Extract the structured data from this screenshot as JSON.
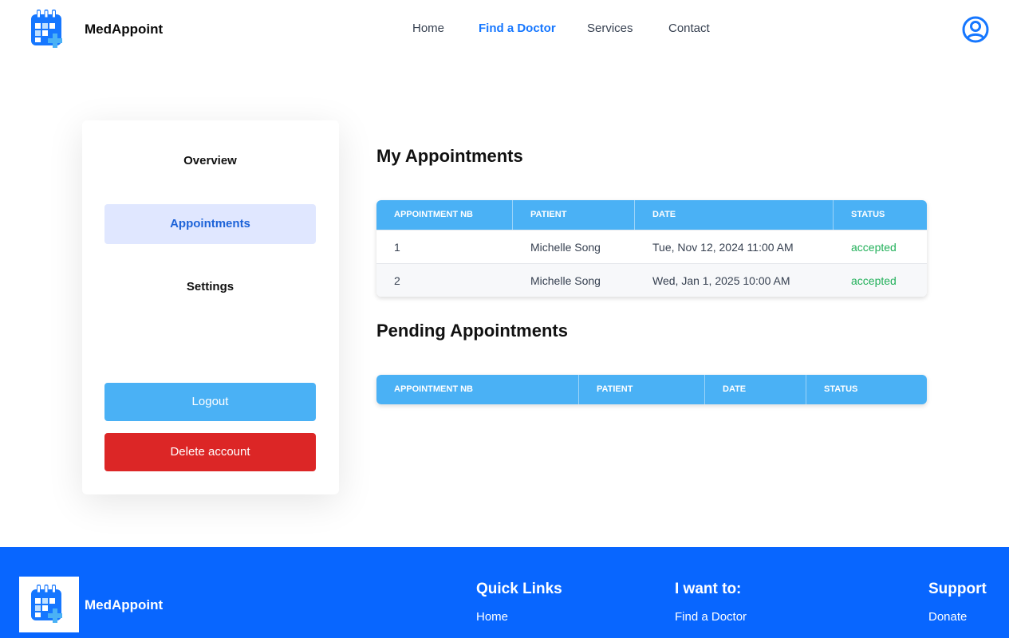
{
  "app": {
    "brand": "MedAppoint"
  },
  "nav": {
    "home": "Home",
    "find_doctor": "Find a Doctor",
    "services": "Services",
    "contact": "Contact"
  },
  "sidebar": {
    "overview": "Overview",
    "appointments": "Appointments",
    "settings": "Settings",
    "logout": "Logout",
    "delete_account": "Delete account"
  },
  "my_appointments": {
    "title": "My Appointments",
    "columns": [
      "APPOINTMENT NB",
      "PATIENT",
      "DATE",
      "STATUS"
    ],
    "rows": [
      {
        "nb": "1",
        "patient": "Michelle Song",
        "date": "Tue, Nov 12, 2024 11:00 AM",
        "status": "accepted"
      },
      {
        "nb": "2",
        "patient": "Michelle Song",
        "date": "Wed, Jan 1, 2025 10:00 AM",
        "status": "accepted"
      }
    ]
  },
  "pending_appointments": {
    "title": "Pending Appointments",
    "columns": [
      "APPOINTMENT NB",
      "PATIENT",
      "DATE",
      "STATUS"
    ],
    "rows": []
  },
  "footer": {
    "brand": "MedAppoint",
    "quick_links": {
      "title": "Quick Links",
      "first_link": "Home"
    },
    "i_want_to": {
      "title": "I want to:",
      "first_link": "Find a Doctor"
    },
    "support": {
      "title": "Support",
      "first_link": "Donate"
    }
  },
  "colors": {
    "primary": "#0866ff",
    "table_header": "#4ab1f5",
    "danger": "#dc2626",
    "success": "#22b05a",
    "active_bg": "#e0e7ff"
  },
  "icons": {
    "logo": "calendar-plus-icon",
    "user": "user-circle-icon"
  }
}
